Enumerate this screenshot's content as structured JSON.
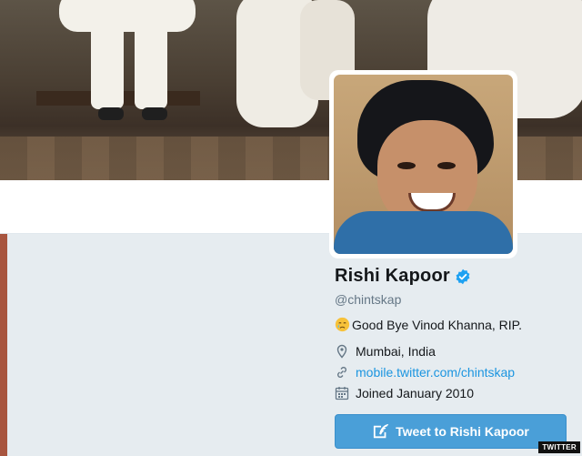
{
  "profile": {
    "name": "Rishi Kapoor",
    "handle": "@chintskap",
    "bio_text": "Good Bye Vinod Khanna, RIP.",
    "bio_emoji": "crying-face-emoji",
    "location": "Mumbai, India",
    "website": "mobile.twitter.com/chintskap",
    "joined": "Joined January 2010",
    "verified": true
  },
  "actions": {
    "tweet_button_label": "Tweet to Rishi Kapoor"
  },
  "icons": {
    "location": "location-pin-icon",
    "link": "link-icon",
    "joined": "calendar-icon",
    "verified": "verified-badge-icon",
    "tweet": "compose-quill-icon"
  },
  "watermark": "TWITTER",
  "colors": {
    "link": "#1b95e0",
    "button": "#4a9fd8",
    "background": "#e6ecf0",
    "verified": "#1da1f2"
  }
}
